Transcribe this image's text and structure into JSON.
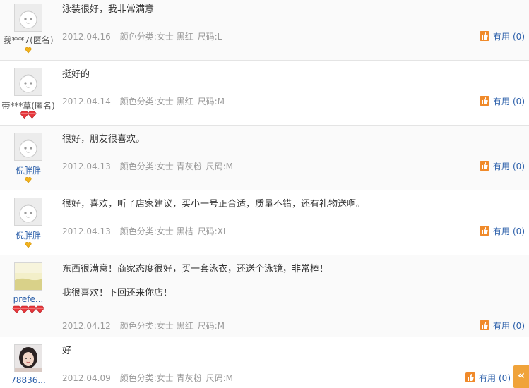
{
  "reviews": [
    {
      "user": "我***7(匿名)",
      "rank_icons": 1,
      "rank_type": "heart-yellow",
      "content": [
        "泳装很好，我非常满意"
      ],
      "date": "2012.04.16",
      "color_label": "颜色分类:女士 黑红",
      "size_label": "尺码:L",
      "useful_label": "有用",
      "useful_count": "(0)",
      "avatar": "default"
    },
    {
      "user": "带***草(匿名)",
      "rank_icons": 2,
      "rank_type": "heart-red",
      "content": [
        "挺好的"
      ],
      "date": "2012.04.14",
      "color_label": "颜色分类:女士 黑红",
      "size_label": "尺码:M",
      "useful_label": "有用",
      "useful_count": "(0)",
      "avatar": "default"
    },
    {
      "user": "倪胖胖",
      "rank_icons": 1,
      "rank_type": "heart-yellow",
      "content": [
        "很好，朋友很喜欢。"
      ],
      "date": "2012.04.13",
      "color_label": "颜色分类:女士 青灰粉",
      "size_label": "尺码:M",
      "useful_label": "有用",
      "useful_count": "(0)",
      "avatar": "default"
    },
    {
      "user": "倪胖胖",
      "rank_icons": 1,
      "rank_type": "heart-yellow",
      "content": [
        "很好，喜欢，听了店家建议，买小一号正合适，质量不错，还有礼物送啊。"
      ],
      "date": "2012.04.13",
      "color_label": "颜色分类:女士 黑桔",
      "size_label": "尺码:XL",
      "useful_label": "有用",
      "useful_count": "(0)",
      "avatar": "default"
    },
    {
      "user": "prefe...",
      "rank_icons": 4,
      "rank_type": "heart-red",
      "content": [
        "东西很满意！商家态度很好，买一套泳衣，还送个泳镜，非常棒！",
        "我很喜欢！下回还来你店！"
      ],
      "date": "2012.04.12",
      "color_label": "颜色分类:女士 黑红",
      "size_label": "尺码:M",
      "useful_label": "有用",
      "useful_count": "(0)",
      "avatar": "landscape"
    },
    {
      "user": "78836...",
      "rank_icons": 0,
      "rank_type": "none",
      "content": [
        "好"
      ],
      "date": "2012.04.09",
      "color_label": "颜色分类:女士 青灰粉",
      "size_label": "尺码:M",
      "useful_label": "有用",
      "useful_count": "(0)",
      "avatar": "photo"
    }
  ],
  "collapse_glyph": "«",
  "colors": {
    "link": "#2a5ea9",
    "meta": "#999999",
    "useful_icon": "#f08a2a",
    "collapse_tab": "#f0a33a"
  }
}
